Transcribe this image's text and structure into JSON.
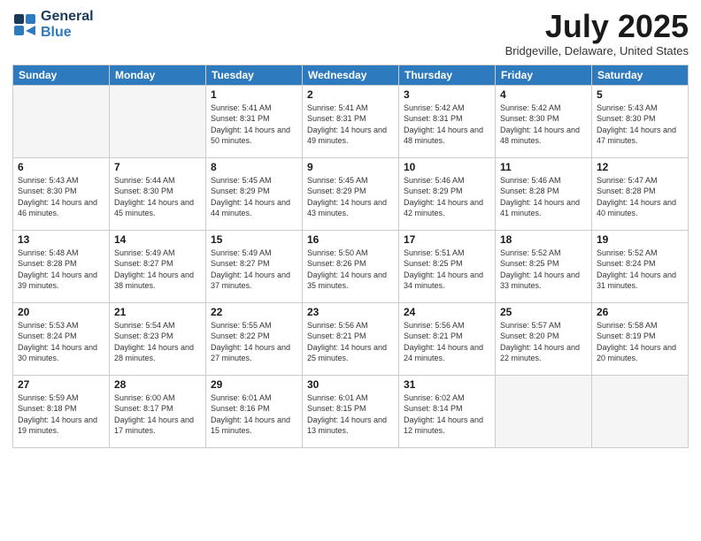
{
  "header": {
    "logo_general": "General",
    "logo_blue": "Blue",
    "month_title": "July 2025",
    "location": "Bridgeville, Delaware, United States"
  },
  "days_of_week": [
    "Sunday",
    "Monday",
    "Tuesday",
    "Wednesday",
    "Thursday",
    "Friday",
    "Saturday"
  ],
  "weeks": [
    [
      {
        "day": "",
        "empty": true
      },
      {
        "day": "",
        "empty": true
      },
      {
        "day": "1",
        "sunrise": "5:41 AM",
        "sunset": "8:31 PM",
        "daylight": "14 hours and 50 minutes."
      },
      {
        "day": "2",
        "sunrise": "5:41 AM",
        "sunset": "8:31 PM",
        "daylight": "14 hours and 49 minutes."
      },
      {
        "day": "3",
        "sunrise": "5:42 AM",
        "sunset": "8:31 PM",
        "daylight": "14 hours and 48 minutes."
      },
      {
        "day": "4",
        "sunrise": "5:42 AM",
        "sunset": "8:30 PM",
        "daylight": "14 hours and 48 minutes."
      },
      {
        "day": "5",
        "sunrise": "5:43 AM",
        "sunset": "8:30 PM",
        "daylight": "14 hours and 47 minutes."
      }
    ],
    [
      {
        "day": "6",
        "sunrise": "5:43 AM",
        "sunset": "8:30 PM",
        "daylight": "14 hours and 46 minutes."
      },
      {
        "day": "7",
        "sunrise": "5:44 AM",
        "sunset": "8:30 PM",
        "daylight": "14 hours and 45 minutes."
      },
      {
        "day": "8",
        "sunrise": "5:45 AM",
        "sunset": "8:29 PM",
        "daylight": "14 hours and 44 minutes."
      },
      {
        "day": "9",
        "sunrise": "5:45 AM",
        "sunset": "8:29 PM",
        "daylight": "14 hours and 43 minutes."
      },
      {
        "day": "10",
        "sunrise": "5:46 AM",
        "sunset": "8:29 PM",
        "daylight": "14 hours and 42 minutes."
      },
      {
        "day": "11",
        "sunrise": "5:46 AM",
        "sunset": "8:28 PM",
        "daylight": "14 hours and 41 minutes."
      },
      {
        "day": "12",
        "sunrise": "5:47 AM",
        "sunset": "8:28 PM",
        "daylight": "14 hours and 40 minutes."
      }
    ],
    [
      {
        "day": "13",
        "sunrise": "5:48 AM",
        "sunset": "8:28 PM",
        "daylight": "14 hours and 39 minutes."
      },
      {
        "day": "14",
        "sunrise": "5:49 AM",
        "sunset": "8:27 PM",
        "daylight": "14 hours and 38 minutes."
      },
      {
        "day": "15",
        "sunrise": "5:49 AM",
        "sunset": "8:27 PM",
        "daylight": "14 hours and 37 minutes."
      },
      {
        "day": "16",
        "sunrise": "5:50 AM",
        "sunset": "8:26 PM",
        "daylight": "14 hours and 35 minutes."
      },
      {
        "day": "17",
        "sunrise": "5:51 AM",
        "sunset": "8:25 PM",
        "daylight": "14 hours and 34 minutes."
      },
      {
        "day": "18",
        "sunrise": "5:52 AM",
        "sunset": "8:25 PM",
        "daylight": "14 hours and 33 minutes."
      },
      {
        "day": "19",
        "sunrise": "5:52 AM",
        "sunset": "8:24 PM",
        "daylight": "14 hours and 31 minutes."
      }
    ],
    [
      {
        "day": "20",
        "sunrise": "5:53 AM",
        "sunset": "8:24 PM",
        "daylight": "14 hours and 30 minutes."
      },
      {
        "day": "21",
        "sunrise": "5:54 AM",
        "sunset": "8:23 PM",
        "daylight": "14 hours and 28 minutes."
      },
      {
        "day": "22",
        "sunrise": "5:55 AM",
        "sunset": "8:22 PM",
        "daylight": "14 hours and 27 minutes."
      },
      {
        "day": "23",
        "sunrise": "5:56 AM",
        "sunset": "8:21 PM",
        "daylight": "14 hours and 25 minutes."
      },
      {
        "day": "24",
        "sunrise": "5:56 AM",
        "sunset": "8:21 PM",
        "daylight": "14 hours and 24 minutes."
      },
      {
        "day": "25",
        "sunrise": "5:57 AM",
        "sunset": "8:20 PM",
        "daylight": "14 hours and 22 minutes."
      },
      {
        "day": "26",
        "sunrise": "5:58 AM",
        "sunset": "8:19 PM",
        "daylight": "14 hours and 20 minutes."
      }
    ],
    [
      {
        "day": "27",
        "sunrise": "5:59 AM",
        "sunset": "8:18 PM",
        "daylight": "14 hours and 19 minutes."
      },
      {
        "day": "28",
        "sunrise": "6:00 AM",
        "sunset": "8:17 PM",
        "daylight": "14 hours and 17 minutes."
      },
      {
        "day": "29",
        "sunrise": "6:01 AM",
        "sunset": "8:16 PM",
        "daylight": "14 hours and 15 minutes."
      },
      {
        "day": "30",
        "sunrise": "6:01 AM",
        "sunset": "8:15 PM",
        "daylight": "14 hours and 13 minutes."
      },
      {
        "day": "31",
        "sunrise": "6:02 AM",
        "sunset": "8:14 PM",
        "daylight": "14 hours and 12 minutes."
      },
      {
        "day": "",
        "empty": true
      },
      {
        "day": "",
        "empty": true
      }
    ]
  ]
}
